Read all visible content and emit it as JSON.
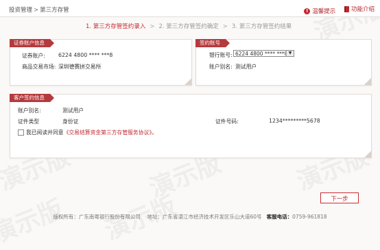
{
  "breadcrumb": {
    "parent": "投资管理",
    "separator": ">",
    "current": "第三方存管"
  },
  "top_links": {
    "warm_tip": "温馨提示",
    "func_intro": "功能介绍"
  },
  "steps": [
    {
      "label": "1. 第三方存管签约录入",
      "active": true
    },
    {
      "label": "2. 第三方存管签约确定",
      "active": false
    },
    {
      "label": "3. 第三方存管签约结果",
      "active": false
    }
  ],
  "step_arrow": ">",
  "securities_account": {
    "title": "证券账户信息",
    "account_label": "证券账户:",
    "account_value": "6224 4800 **** ***8",
    "market_label": "商品交易市场:",
    "market_value": "深圳德赛拼交易所"
  },
  "signing_account": {
    "title": "签约账号",
    "bank_label": "银行账号:",
    "bank_selected": "6224 4800 **** ***8",
    "alias_label": "账户别名:",
    "alias_value": "测试用户"
  },
  "customer_info": {
    "title": "客户签约信息",
    "alias_label": "账户别名:",
    "alias_value": "测试用户",
    "id_type_label": "证件类型",
    "id_type_value": "身份证",
    "id_no_label": "证件号码:",
    "id_no_value": "1234*********5678",
    "agree_text": "我已阅读并同意",
    "agree_link": "《交易结算资金第三方存管服务协议》",
    "agree_end": "。"
  },
  "next_button": "下一步",
  "footer": {
    "rights": "版权所有：广东南粤银行股份有限公司",
    "address": "地址：广东省湛江市经济技术开发区乐山大道60号",
    "phone_label": "客服电话：",
    "phone_value": "0759-961818"
  },
  "watermark_text": "演示版",
  "colors": {
    "accent": "#c0282d",
    "label_bg": "#b5393d"
  }
}
